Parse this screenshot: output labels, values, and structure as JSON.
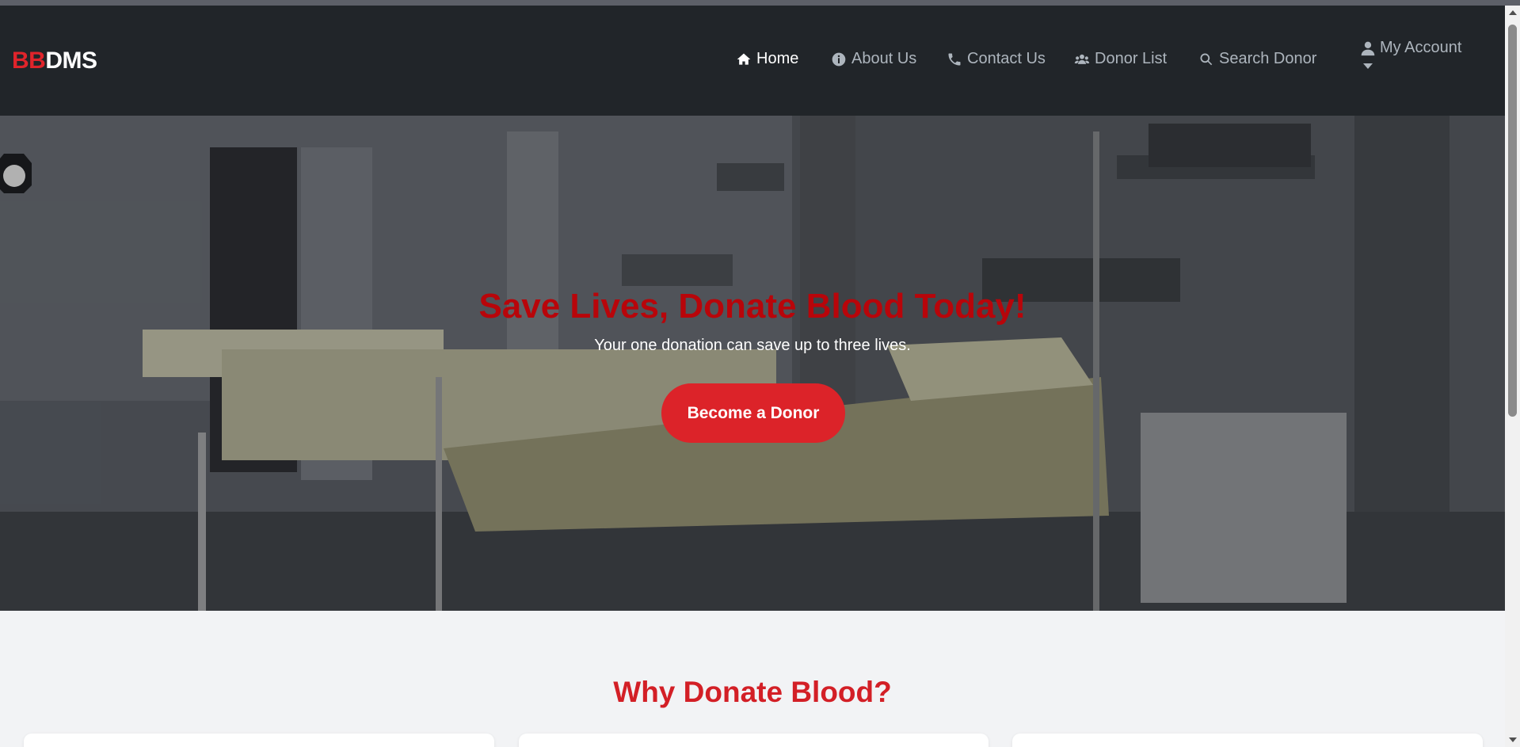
{
  "brand": {
    "prefix": "BB",
    "suffix": "DMS"
  },
  "nav": {
    "items": [
      {
        "label": "Home",
        "icon": "home-icon",
        "active": true
      },
      {
        "label": "About Us",
        "icon": "info-icon",
        "active": false
      },
      {
        "label": "Contact Us",
        "icon": "phone-icon",
        "active": false
      },
      {
        "label": "Donor List",
        "icon": "users-icon",
        "active": false
      },
      {
        "label": "Search Donor",
        "icon": "search-icon",
        "active": false
      }
    ],
    "account": {
      "label": "My Account",
      "icon": "user-icon"
    }
  },
  "hero": {
    "title": "Save Lives, Donate Blood Today!",
    "subtitle": "Your one donation can save up to three lives.",
    "cta_label": "Become a Donor"
  },
  "why": {
    "title": "Why Donate Blood?"
  },
  "colors": {
    "navbar_bg": "#212529",
    "brand_red": "#e0242b",
    "hero_title": "#b8050a",
    "cta_bg": "#dc2329",
    "section_title": "#d31f26",
    "page_bg": "#f2f3f5"
  }
}
